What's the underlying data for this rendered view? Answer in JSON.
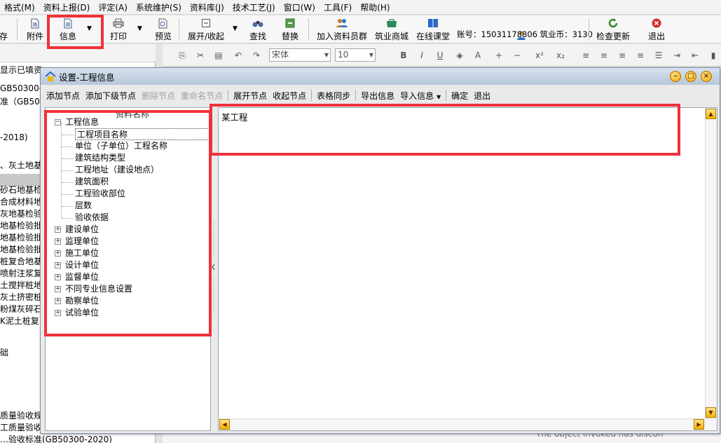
{
  "menubar": {
    "items": [
      "格式(M)",
      "资料上报(D)",
      "评定(A)",
      "系统维护(S)",
      "资料库(J)",
      "技术工艺(J)",
      "窗口(W)",
      "工具(F)",
      "帮助(H)"
    ]
  },
  "toolbar": {
    "save": "存",
    "attach": "附件",
    "info": "信息",
    "print": "打印",
    "preview": "预览",
    "expand_collapse": "展开/收起",
    "find": "查找",
    "replace": "替换",
    "join_group": "加入资料员群",
    "mall": "筑业商城",
    "online_class": "在线课堂",
    "account": "账号：15031178806 筑业币：3130",
    "check_update": "检查更新",
    "exit": "退出"
  },
  "left_pane": {
    "rows": [
      "显示已填资",
      "GB50300-",
      "准（GB5030",
      "",
      "-2018)",
      "、灰土地基",
      "",
      "砂石地基检",
      "合成材料地",
      "灰地基检验",
      "地基检验批",
      "地基检验批",
      "地基检验批",
      "桩复合地基",
      "喷射注浆复",
      "土搅拌桩地",
      "灰土挤密桩",
      "粉煤灰碎石",
      "K泥土桩复",
      "",
      "础",
      "",
      "",
      "",
      "",
      "质量验收规",
      "工质量验收",
      "…验收标准(GB50300-2020)"
    ]
  },
  "editor_toolbar": {
    "font": "宋体",
    "size": "10"
  },
  "dialog": {
    "title": "设置-工程信息",
    "menu": {
      "add_node": "添加节点",
      "add_child": "添加下级节点",
      "delete_node": "删除节点",
      "rename_node": "重命名节点",
      "expand_node": "展开节点",
      "collapse_node": "收起节点",
      "table_sync": "表格同步",
      "export_info": "导出信息",
      "import_info": "导入信息",
      "confirm": "确定",
      "exit": "退出"
    },
    "tree_header": "资料名称",
    "tree": {
      "root": "工程信息",
      "children": [
        "工程项目名称",
        "单位（子单位）工程名称",
        "建筑结构类型",
        "工程地址（建设地点）",
        "建筑面积",
        "工程验收部位",
        "层数",
        "验收依据"
      ],
      "siblings": [
        "建设单位",
        "监理单位",
        "施工单位",
        "设计单位",
        "监督单位",
        "不同专业信息设置",
        "勘察单位",
        "试验单位"
      ]
    },
    "editor_text": "某工程"
  },
  "status_message": "The object invoked has discon",
  "colors": {
    "highlight_red": "#f0303a",
    "dialog_title": "#b7c7da"
  }
}
